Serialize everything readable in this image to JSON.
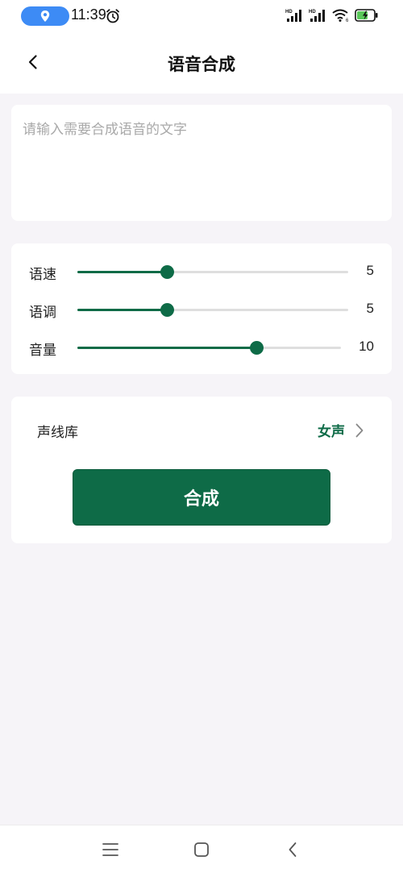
{
  "status_bar": {
    "time": "11:39",
    "icons": [
      "location-icon",
      "alarm-icon",
      "signal-hd-icon",
      "signal-hd-icon",
      "wifi-icon",
      "battery-charging-icon"
    ],
    "signal_tag": "HD",
    "wifi_tag": "6"
  },
  "header": {
    "title": "语音合成",
    "back_icon": "chevron-left-icon"
  },
  "text_input": {
    "placeholder": "请输入需要合成语音的文字",
    "value": ""
  },
  "sliders": [
    {
      "label": "语速",
      "value": "5",
      "fraction": 0.33
    },
    {
      "label": "语调",
      "value": "5",
      "fraction": 0.33
    },
    {
      "label": "音量",
      "value": "10",
      "fraction": 0.68
    }
  ],
  "voice": {
    "label": "声线库",
    "value": "女声",
    "icon": "chevron-right-icon"
  },
  "synthesize_button": "合成",
  "nav_bar": {
    "icons": [
      "menu-icon",
      "home-icon",
      "back-icon"
    ]
  },
  "colors": {
    "accent": "#0e6b47",
    "page_background": "#f6f4f8",
    "location_pill": "#3d8bf5"
  }
}
